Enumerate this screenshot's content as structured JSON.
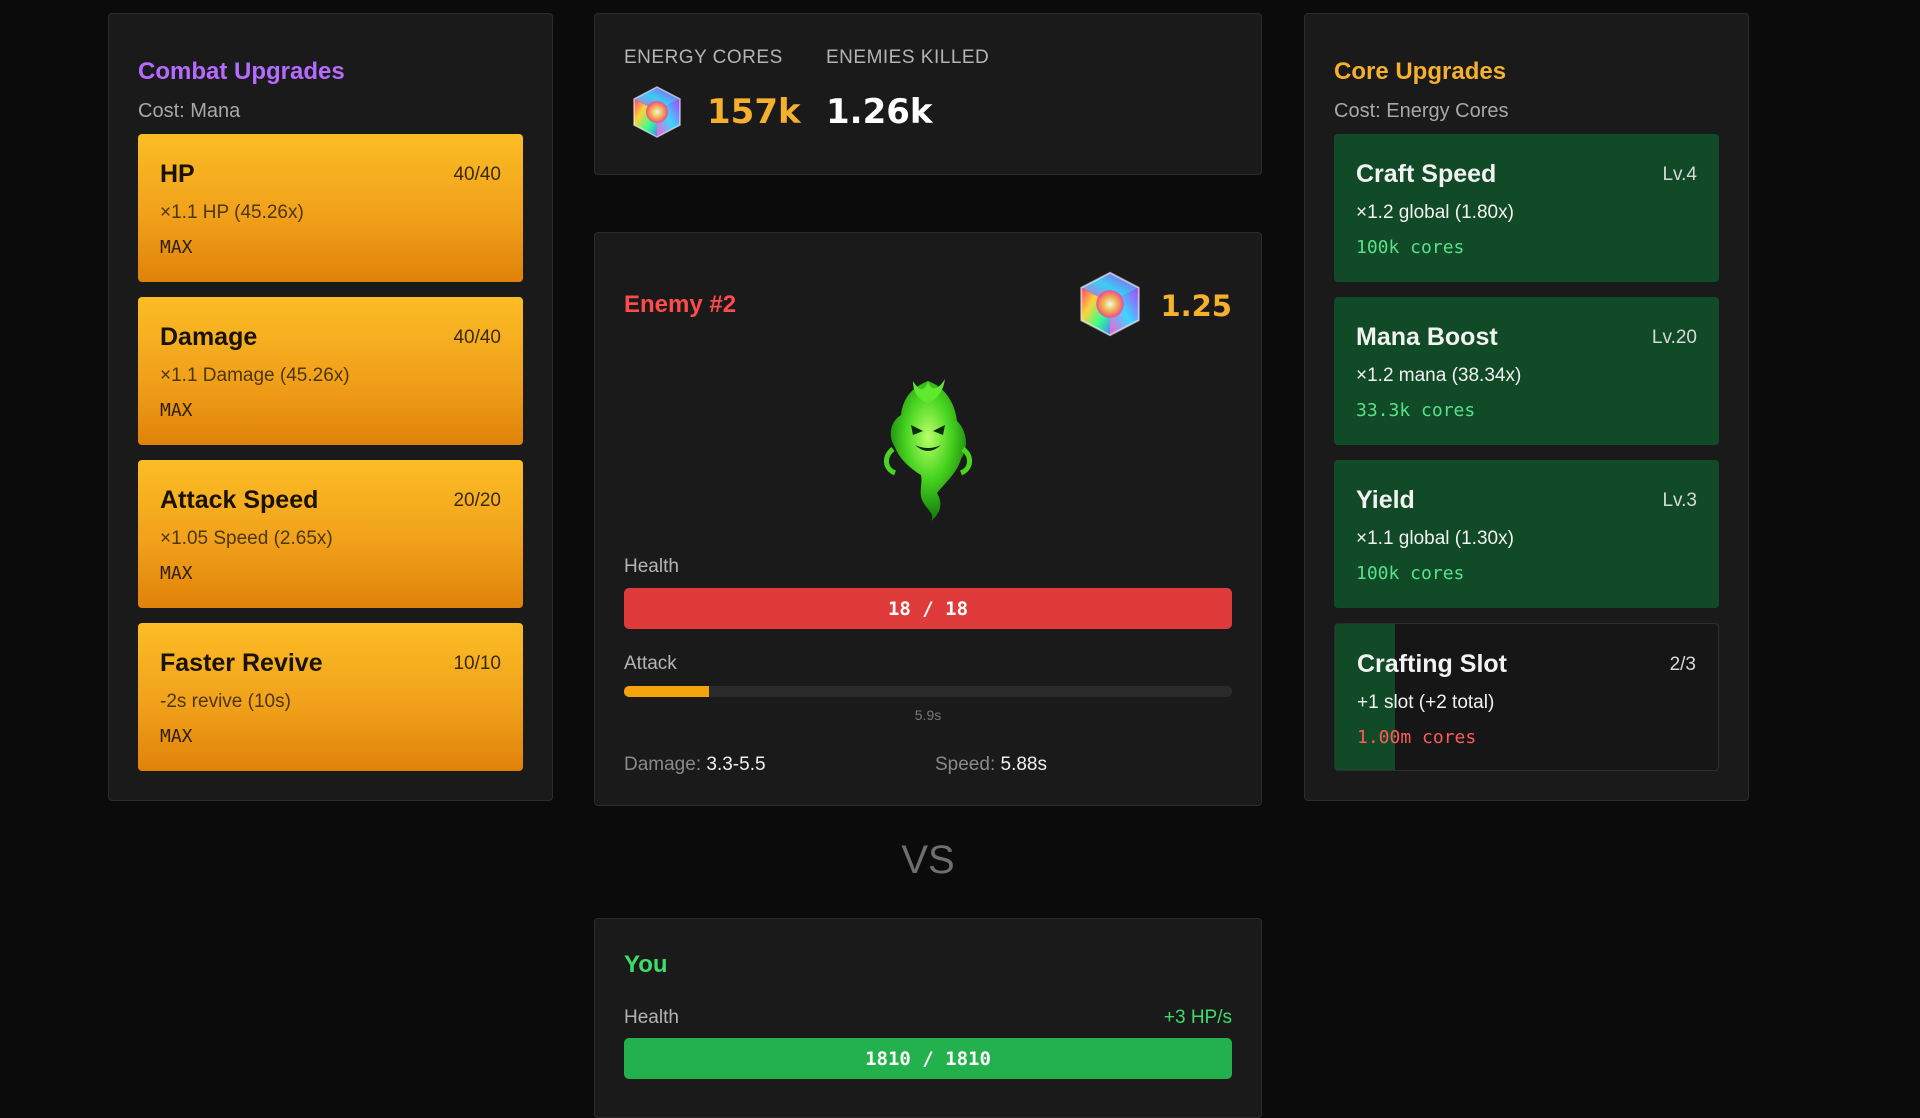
{
  "combat_upgrades": {
    "title": "Combat Upgrades",
    "cost": "Cost: Mana",
    "items": [
      {
        "name": "HP",
        "level": "40/40",
        "desc": "×1.1 HP (45.26x)",
        "status": "MAX"
      },
      {
        "name": "Damage",
        "level": "40/40",
        "desc": "×1.1 Damage (45.26x)",
        "status": "MAX"
      },
      {
        "name": "Attack Speed",
        "level": "20/20",
        "desc": "×1.05 Speed (2.65x)",
        "status": "MAX"
      },
      {
        "name": "Faster Revive",
        "level": "10/10",
        "desc": "-2s revive (10s)",
        "status": "MAX"
      }
    ]
  },
  "stats": {
    "energy_cores_label": "ENERGY CORES",
    "energy_cores_value": "157k",
    "enemies_killed_label": "ENEMIES KILLED",
    "enemies_killed_value": "1.26k"
  },
  "enemy": {
    "title": "Enemy #2",
    "multiplier": "1.25",
    "health_label": "Health",
    "health_text": "18 / 18",
    "health_fraction": 1.0,
    "attack_label": "Attack",
    "attack_fraction": 0.14,
    "attack_timer": "5.9s",
    "damage_label": "Damage:",
    "damage_value": "3.3-5.5",
    "speed_label": "Speed:",
    "speed_value": "5.88s"
  },
  "vs_text": "VS",
  "player": {
    "title": "You",
    "health_label": "Health",
    "regen": "+3 HP/s",
    "health_text": "1810 / 1810",
    "health_fraction": 1.0
  },
  "core_upgrades": {
    "title": "Core Upgrades",
    "cost": "Cost: Energy Cores",
    "items": [
      {
        "name": "Craft Speed",
        "level": "Lv.4",
        "desc": "×1.2 global (1.80x)",
        "cost": "100k cores"
      },
      {
        "name": "Mana Boost",
        "level": "Lv.20",
        "desc": "×1.2 mana (38.34x)",
        "cost": "33.3k cores"
      },
      {
        "name": "Yield",
        "level": "Lv.3",
        "desc": "×1.1 global (1.30x)",
        "cost": "100k cores"
      },
      {
        "name": "Crafting Slot",
        "level": "2/3",
        "desc": "+1 slot (+2 total)",
        "cost": "1.00m cores"
      }
    ]
  },
  "colors": {
    "accent_purple": "#b56bff",
    "accent_gold": "#f5b02e",
    "enemy_red": "#ff4b4b",
    "player_green": "#3ddc6b",
    "health_red": "#e03b3b",
    "health_green": "#22b14c",
    "attack_orange": "#f5a30a"
  },
  "icons": {
    "energy_core": "rainbow-cube-icon",
    "enemy_sprite": "green-ghost-icon"
  }
}
